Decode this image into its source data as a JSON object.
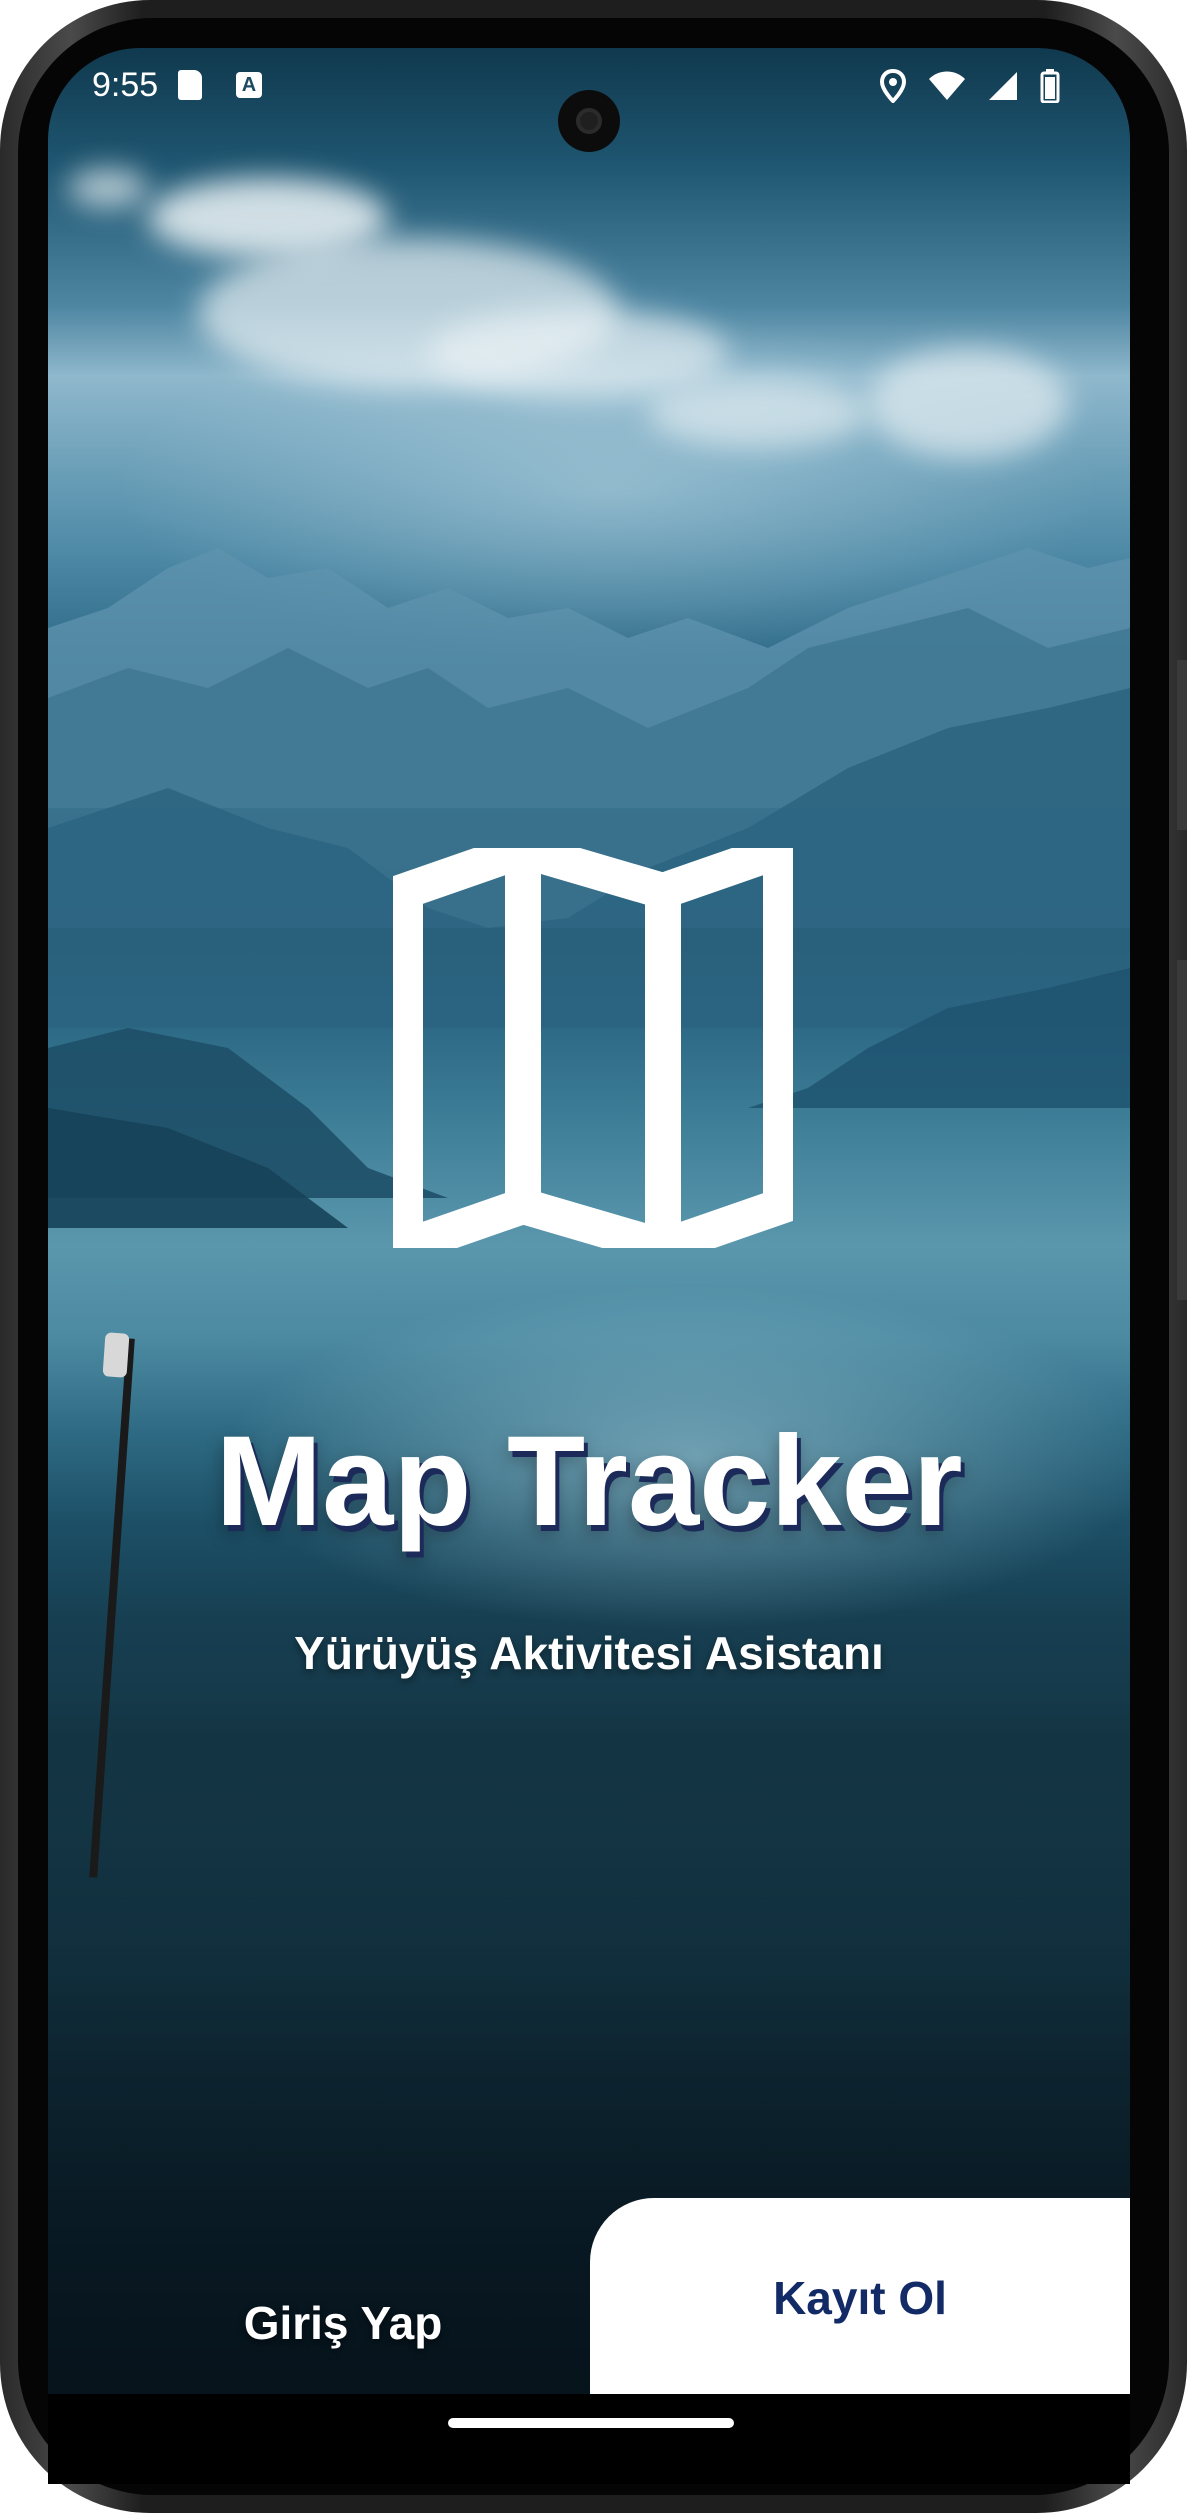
{
  "status_bar": {
    "time": "9:55",
    "left_icons": [
      "sd-card-icon",
      "autofill-a-icon"
    ],
    "right_icons": [
      "location-pin-icon",
      "wifi-icon",
      "cellular-signal-icon",
      "battery-icon"
    ]
  },
  "app": {
    "logo_icon": "folded-map-icon",
    "title": "Map Tracker",
    "subtitle": "Yürüyüş Aktivitesi Asistanı"
  },
  "actions": {
    "login_label": "Giriş Yap",
    "register_label": "Kayıt Ol"
  },
  "colors": {
    "accent_dark_blue": "#122a66",
    "title_shadow": "#1c2a5a",
    "panel_white": "#ffffff"
  }
}
